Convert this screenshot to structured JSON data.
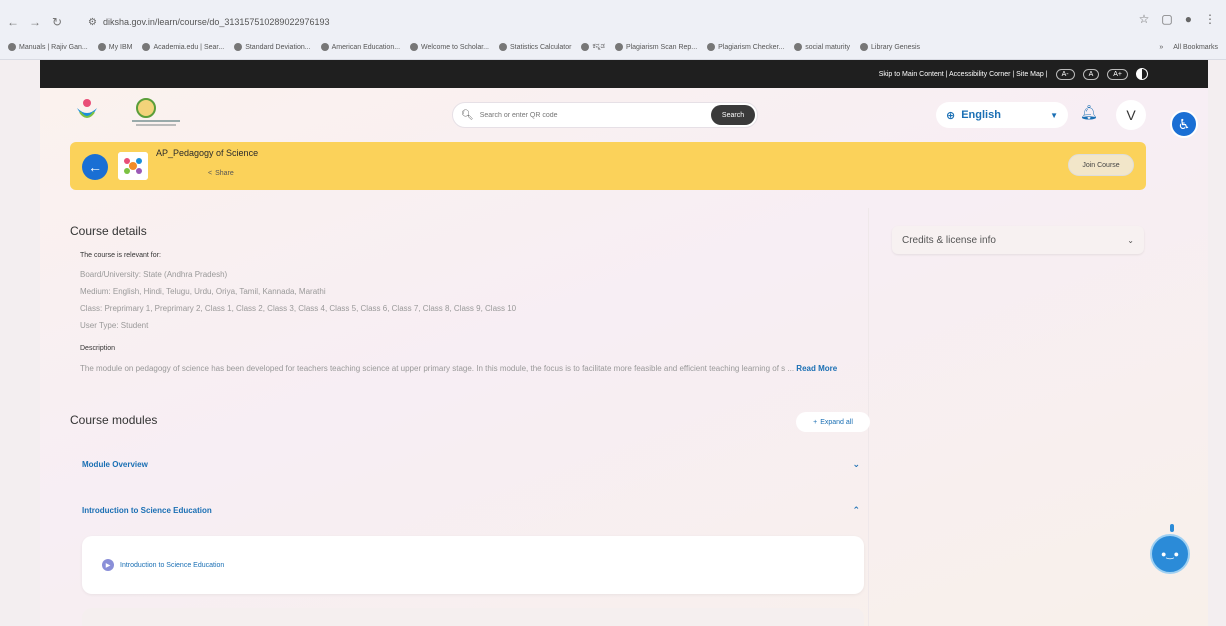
{
  "browser": {
    "url": "diksha.gov.in/learn/course/do_313157510289022976193",
    "bookmarks": [
      "Manuals | Rajiv Gan...",
      "My IBM",
      "Academia.edu | Sear...",
      "Standard Deviation...",
      "American Education...",
      "Welcome to Scholar...",
      "Statistics Calculator",
      "ಕನ್ನಡ",
      "Plagiarism Scan Rep...",
      "Plagiarism Checker...",
      "social maturity",
      "Library Genesis"
    ],
    "all_bookmarks": "All Bookmarks"
  },
  "access_bar": {
    "links": "Skip to Main Content | Accessibility Corner | Site Map |",
    "font_small": "A-",
    "font_normal": "A",
    "font_large": "A+"
  },
  "header": {
    "search_placeholder": "Search or enter QR code",
    "search_button": "Search",
    "language": "English",
    "avatar_initial": "V"
  },
  "course": {
    "title": "AP_Pedagogy of Science",
    "share_label": "Share",
    "join_button": "Join Course"
  },
  "details": {
    "title": "Course details",
    "relevant_for": "The course is relevant for:",
    "board": "Board/University: State (Andhra Pradesh)",
    "medium": "Medium: English, Hindi, Telugu, Urdu, Oriya, Tamil, Kannada, Marathi",
    "class": "Class: Preprimary 1, Preprimary 2, Class 1, Class 2, Class 3, Class 4, Class 5, Class 6, Class 7, Class 8, Class 9, Class 10",
    "user_type": "User Type: Student",
    "description_label": "Description",
    "description": "The module on pedagogy of science has been developed for teachers teaching science at upper primary stage. In this module, the focus is to facilitate more feasible and efficient teaching learning of s ...",
    "read_more": "Read More"
  },
  "credits": {
    "label": "Credits & license info"
  },
  "modules": {
    "title": "Course modules",
    "expand_all": "Expand all",
    "items": [
      {
        "label": "Module Overview"
      },
      {
        "label": "Introduction to Science Education"
      }
    ],
    "lesson": "Introduction to Science Education"
  },
  "colors": {
    "accent": "#1a6fd4",
    "banner": "#fbd25a"
  }
}
